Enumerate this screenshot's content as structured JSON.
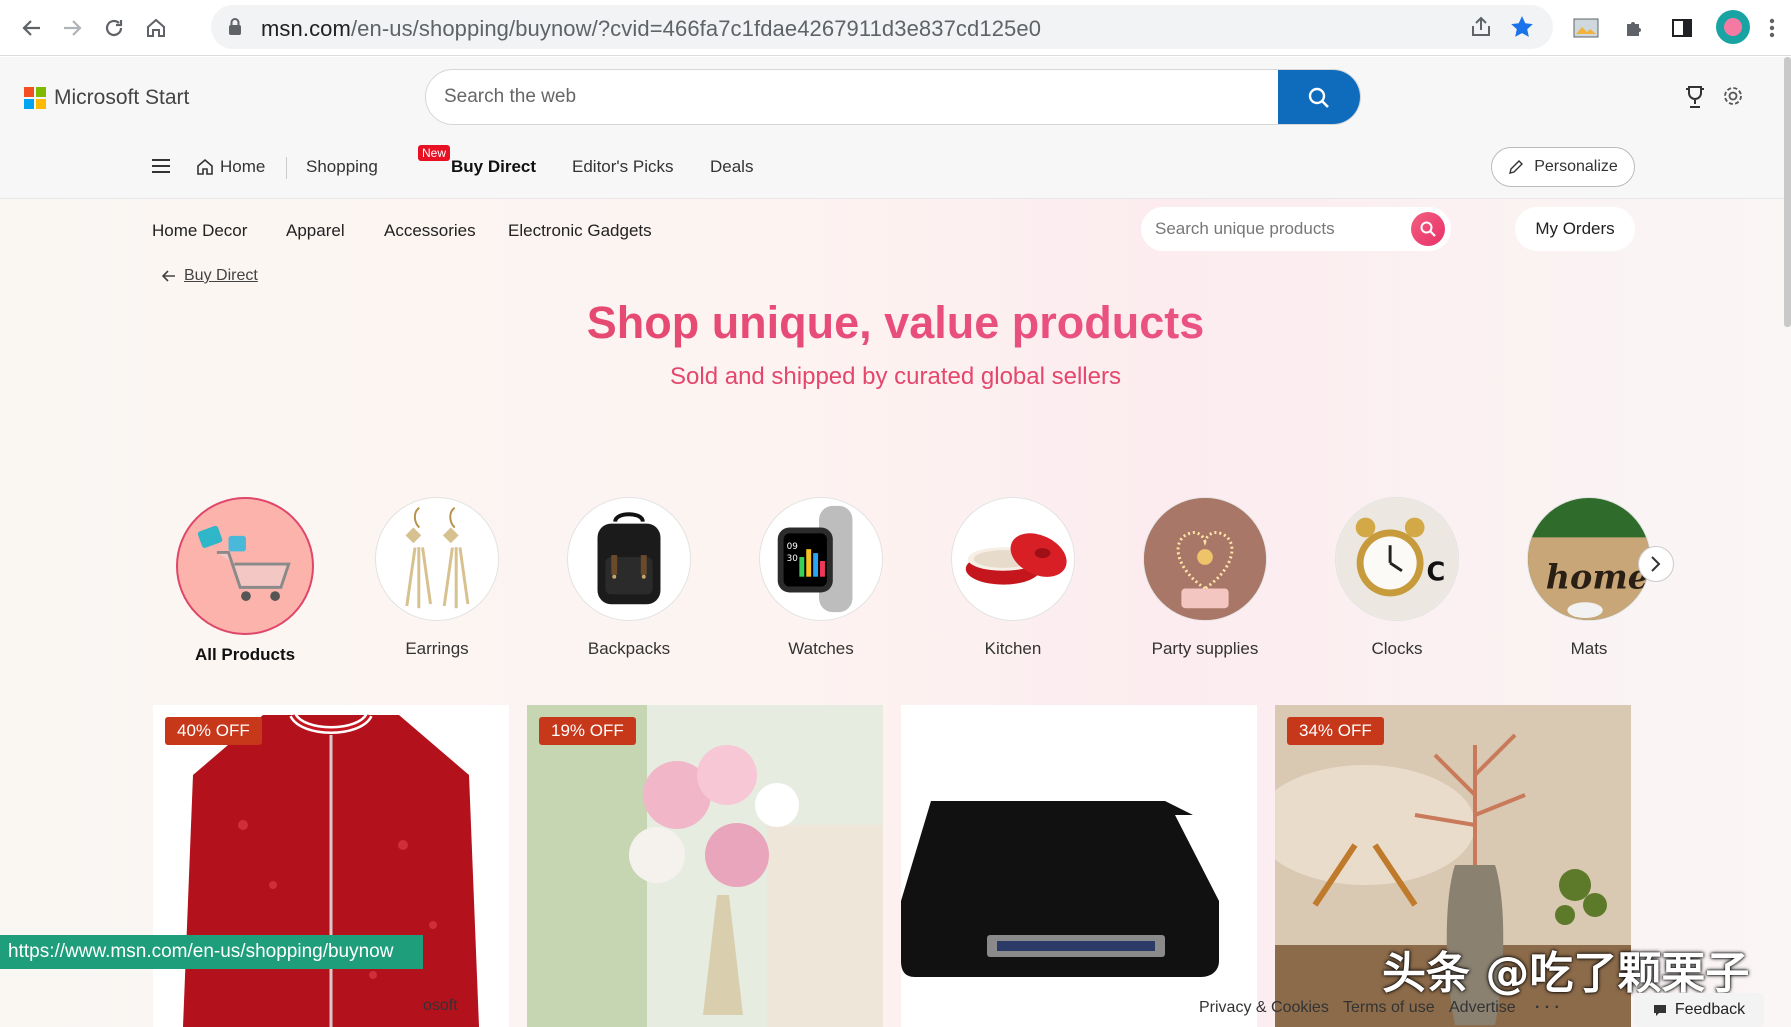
{
  "browser": {
    "url_host": "msn.com",
    "url_path": "/en-us/shopping/buynow/?cvid=466fa7c1fdae4267911d3e837cd125e0"
  },
  "header": {
    "brand": "Microsoft Start",
    "search_placeholder": "Search the web"
  },
  "menu": {
    "home": "Home",
    "shopping": "Shopping",
    "new_badge": "New",
    "buy_direct": "Buy Direct",
    "editors_picks": "Editor's Picks",
    "deals": "Deals",
    "personalize": "Personalize"
  },
  "categories": {
    "home_decor": "Home Decor",
    "apparel": "Apparel",
    "accessories": "Accessories",
    "electronic_gadgets": "Electronic Gadgets",
    "search_placeholder": "Search unique products",
    "my_orders": "My Orders"
  },
  "breadcrumb": {
    "back_label": "Buy Direct"
  },
  "hero": {
    "title": "Shop unique, value products",
    "subtitle": "Sold and shipped by curated global sellers"
  },
  "circle_categories": [
    {
      "label": "All Products",
      "icon": "shopping-cart-icon"
    },
    {
      "label": "Earrings",
      "icon": "earrings-icon"
    },
    {
      "label": "Backpacks",
      "icon": "backpack-icon"
    },
    {
      "label": "Watches",
      "icon": "watch-icon"
    },
    {
      "label": "Kitchen",
      "icon": "pot-icon"
    },
    {
      "label": "Party supplies",
      "icon": "heart-lights-icon"
    },
    {
      "label": "Clocks",
      "icon": "alarm-clock-icon"
    },
    {
      "label": "Mats",
      "icon": "doormat-icon"
    }
  ],
  "products": [
    {
      "badge": "40% OFF",
      "subject": "red sequin jacket"
    },
    {
      "badge": "19% OFF",
      "subject": "artificial roses in vase"
    },
    {
      "badge": "",
      "subject": "black portable drive"
    },
    {
      "badge": "34% OFF",
      "subject": "decorative branch in vase"
    }
  ],
  "status_bar": {
    "url": "https://www.msn.com/en-us/shopping/buynow"
  },
  "footer": {
    "left_fragment": "osoft",
    "privacy": "Privacy & Cookies",
    "terms": "Terms of use",
    "advertise": "Advertise",
    "more": "· · ·",
    "feedback": "Feedback"
  },
  "watermark": "头条 @吃了颗栗子",
  "colors": {
    "accent_pink": "#e5466b",
    "search_blue": "#0f6cbd",
    "discount_badge": "#c7371a",
    "status_bar": "#1e9e7a"
  }
}
